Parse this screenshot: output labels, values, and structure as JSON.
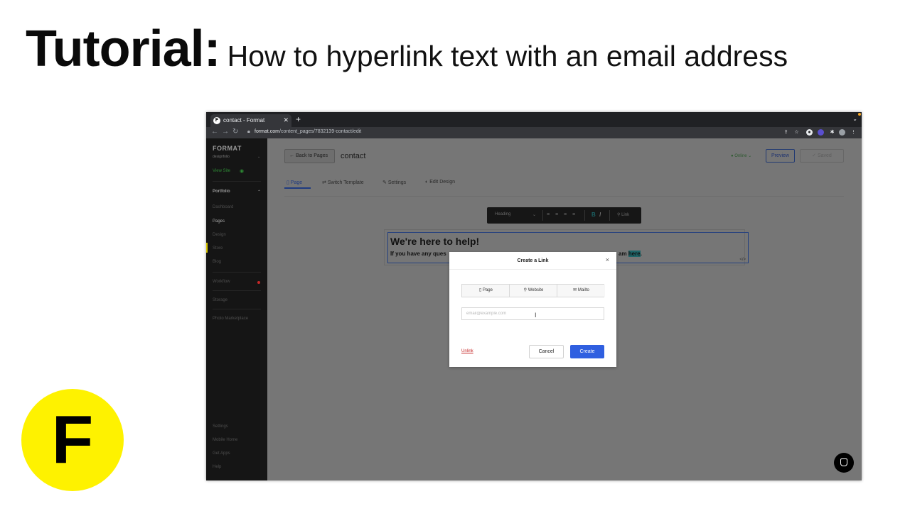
{
  "headline": {
    "bold": "Tutorial:",
    "light": "How to hyperlink text with an email address"
  },
  "logo": {
    "letter": "F",
    "color": "#fef200"
  },
  "browser": {
    "tab_title": "contact - Format",
    "tab_favicon": "F",
    "new_tab": "+",
    "url_host": "format.com",
    "url_path": "/content_pages/7832139-contact/edit"
  },
  "sidebar": {
    "brand": "FORMAT",
    "account": "designfolio",
    "view_site": "View Site",
    "portfolio": "Portfolio",
    "items": [
      "Dashboard",
      "Pages",
      "Design",
      "Store",
      "Blog"
    ],
    "workflow": "Workflow",
    "storage": "Storage",
    "marketplace": "Photo Marketplace",
    "bottom": [
      "Settings",
      "Mobile Home",
      "Get Apps",
      "Help"
    ]
  },
  "main": {
    "back_label": "Back to Pages",
    "title": "contact",
    "status": "Online",
    "preview": "Preview",
    "saved": "Saved",
    "tabs": [
      "Page",
      "Switch Template",
      "Settings",
      "Edit Design"
    ],
    "toolbar": {
      "heading": "Heading",
      "bold": "B",
      "italic": "I",
      "link": "Link"
    },
    "editor": {
      "heading": "We're here to help!",
      "body_start": "If you have any ques",
      "body_end_prefix": "am ",
      "body_highlight": "here",
      "body_end_suffix": ".",
      "code_icon": "</>"
    }
  },
  "modal": {
    "title": "Create a Link",
    "close": "×",
    "options": [
      "Page",
      "Website",
      "Mailto"
    ],
    "input_value": "",
    "input_placeholder": "email@example.com",
    "unlink": "Unlink",
    "cancel": "Cancel",
    "create": "Create"
  },
  "colors": {
    "accent_blue": "#2f5fe0",
    "brand_yellow": "#fef200",
    "online_green": "#2e8b35"
  }
}
